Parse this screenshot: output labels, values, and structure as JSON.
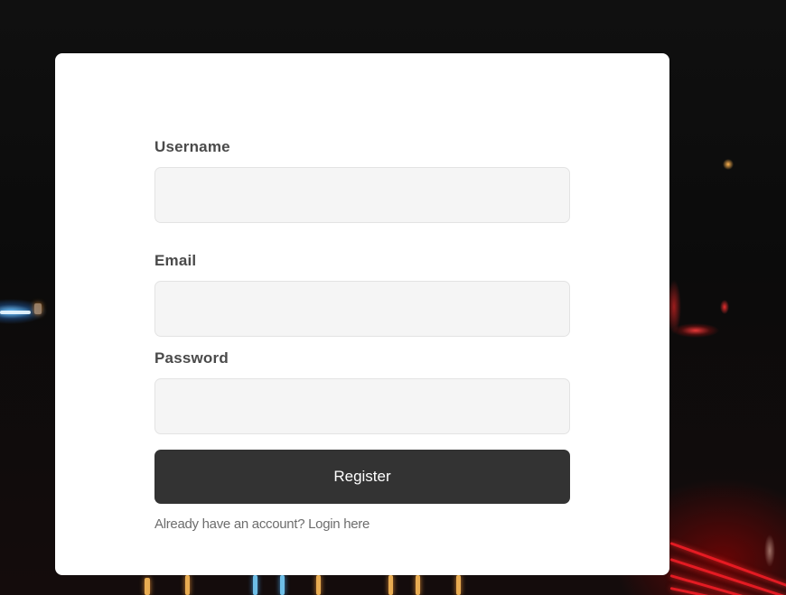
{
  "form": {
    "username": {
      "label": "Username",
      "value": "",
      "placeholder": ""
    },
    "email": {
      "label": "Email",
      "value": "",
      "placeholder": ""
    },
    "password": {
      "label": "Password",
      "value": "",
      "placeholder": ""
    },
    "register_label": "Register",
    "login_link": "Already have an account? Login here"
  },
  "colors": {
    "card": "#ffffff",
    "input_background": "#f5f5f5",
    "button": "#333333",
    "button_text": "#ffffff",
    "label_text": "#4a4a4a",
    "link_text": "#6d6d6d"
  }
}
